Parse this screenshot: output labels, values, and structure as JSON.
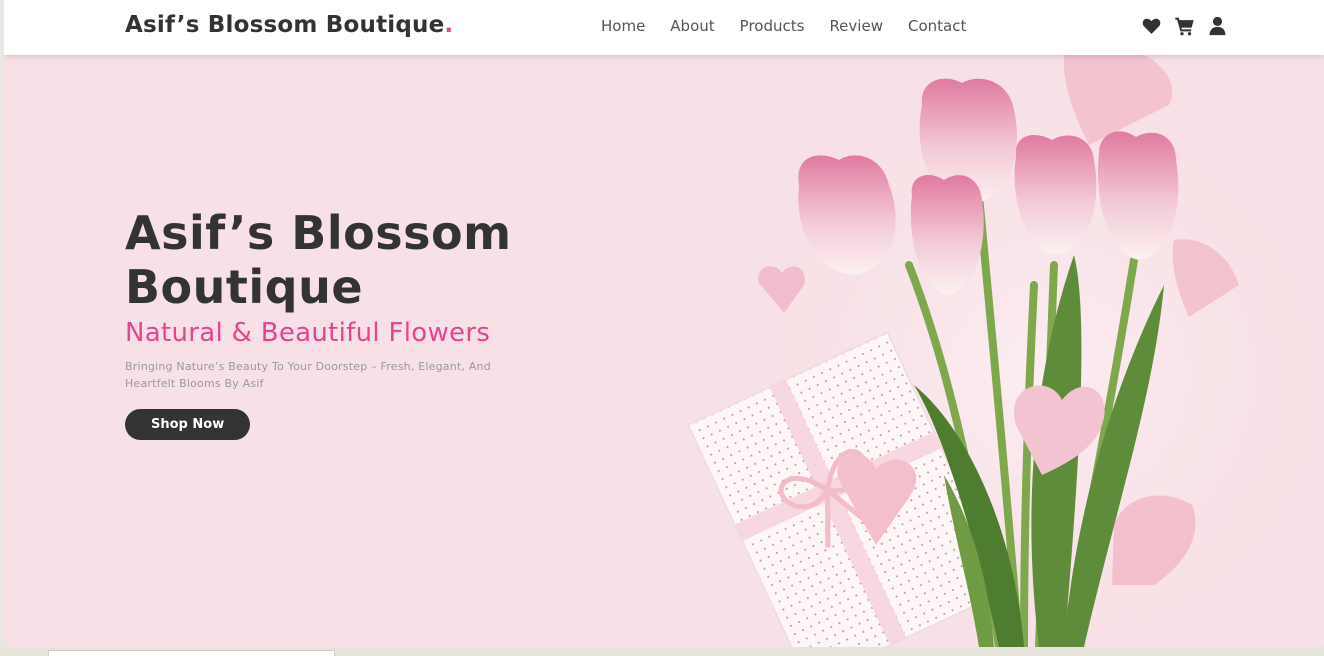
{
  "header": {
    "brand": "Asif’s Blossom Boutique",
    "brand_dot": ".",
    "nav": [
      "Home",
      "About",
      "Products",
      "Review",
      "Contact"
    ],
    "icons": [
      "heart-icon",
      "shopping-cart-icon",
      "user-icon"
    ]
  },
  "hero": {
    "title": "Asif’s Blossom Boutique",
    "subtitle": "Natural & Beautiful Flowers",
    "description": "Bringing Nature’s Beauty To Your Doorstep – Fresh, Elegant, And Heartfelt Blooms By Asif",
    "cta": "Shop Now"
  },
  "colors": {
    "accent": "#e84393",
    "text_dark": "#333333",
    "hero_bg": "#f8e1e6"
  }
}
